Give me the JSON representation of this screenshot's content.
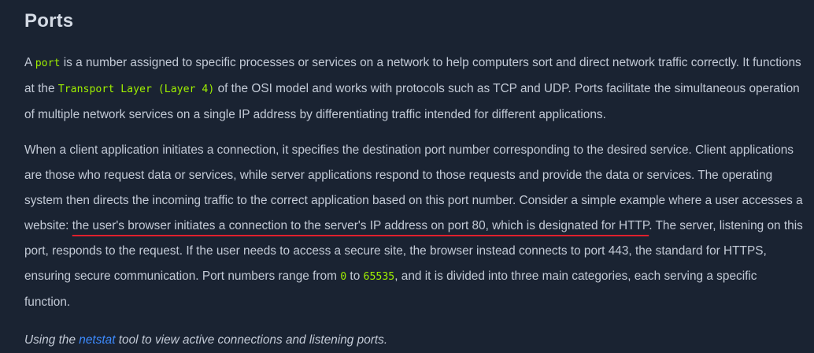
{
  "heading": "Ports",
  "p1": {
    "t1": "A ",
    "code1": "port",
    "t2": " is a number assigned to specific processes or services on a network to help computers sort and direct network traffic correctly. It functions at the ",
    "code2": "Transport Layer (Layer 4)",
    "t3": " of the OSI model and works with protocols such as TCP and UDP. Ports facilitate the simultaneous operation of multiple network services on a single IP address by differentiating traffic intended for different applications."
  },
  "p2": {
    "t1": "When a client application initiates a connection, it specifies the destination port number corresponding to the desired service. Client applications are those who request data or services, while server applications respond to those requests and provide the data or services. The operating system then directs the incoming traffic to the correct application based on this port number. Consider a simple example where a user accesses a website: ",
    "highlight": "the user's browser initiates a connection to the server's IP address on port 80, which is designated for HTTP",
    "t2": ". The server, listening on this port, responds to the request. If the user needs to access a secure site, the browser instead connects to port 443, the standard for HTTPS, ensuring secure communication. Port numbers range from ",
    "code_min": "0",
    "t3": " to ",
    "code_max": "65535",
    "t4": ", and it is divided into three main categories, each serving a specific function."
  },
  "p3": {
    "t1": "Using the ",
    "link": "netstat",
    "t2": " tool to view active connections and listening ports."
  },
  "colors": {
    "background": "#1a2332",
    "text": "#c3cad6",
    "code": "#9fef00",
    "link": "#3d8bff",
    "underline": "#e01f2d"
  }
}
